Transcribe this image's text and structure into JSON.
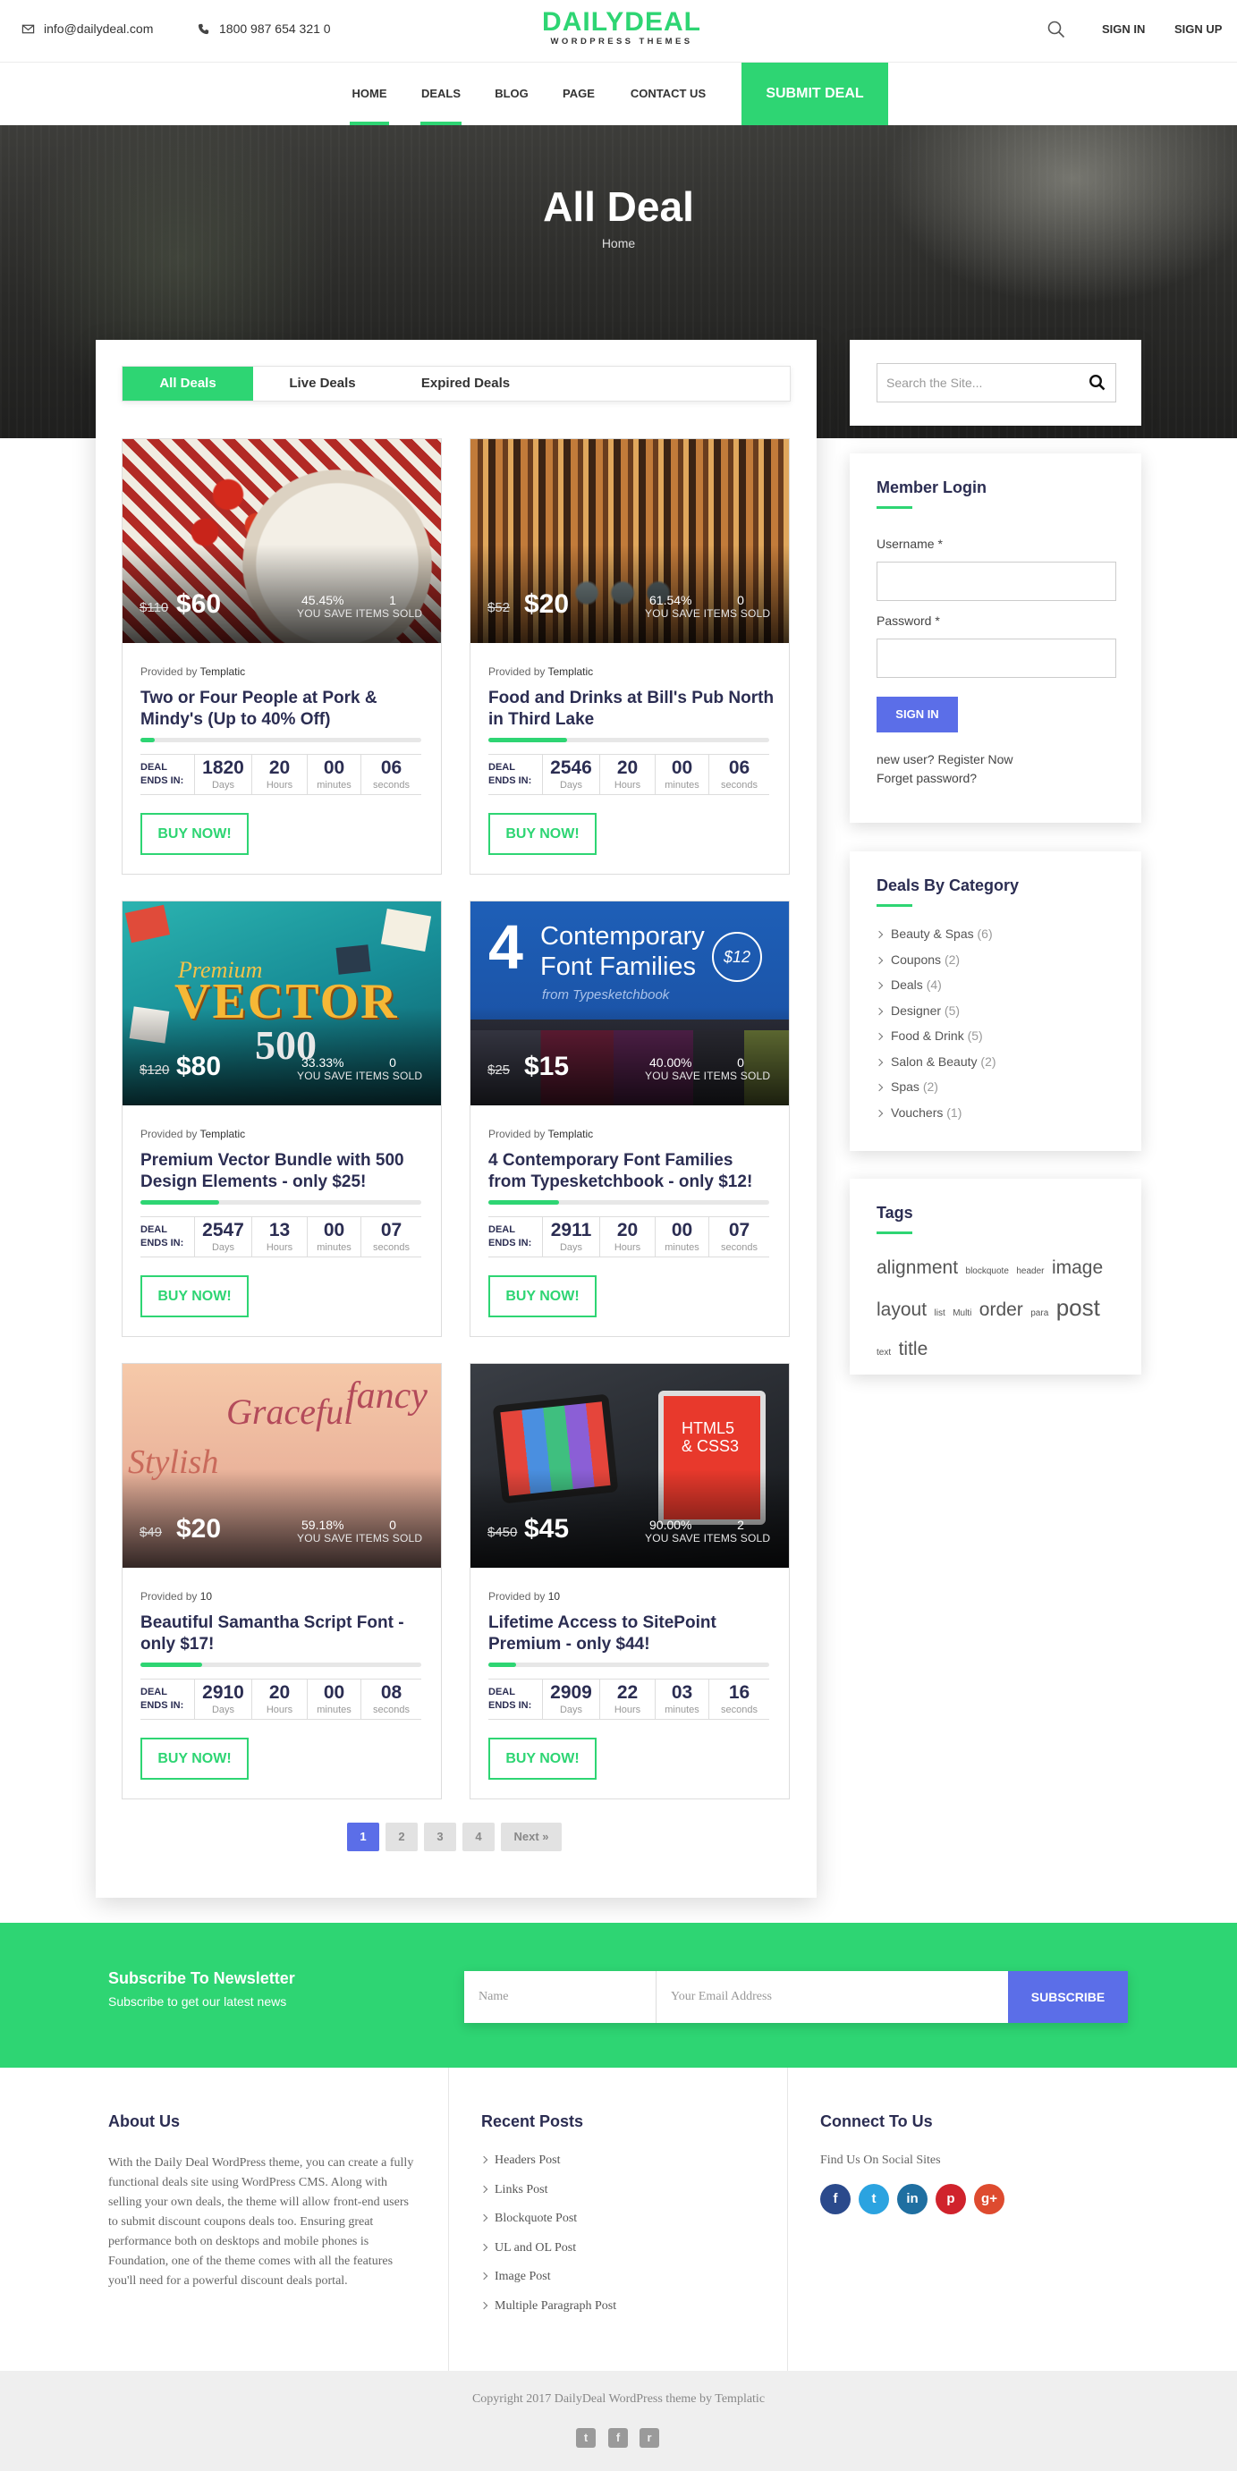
{
  "header": {
    "email": "info@dailydeal.com",
    "phone": "1800 987 654 321 0",
    "logo_main": "DAILYDEAL",
    "logo_sub": "WORDPRESS THEMES",
    "sign_in": "SIGN IN",
    "sign_up": "SIGN UP",
    "nav": [
      "HOME",
      "DEALS",
      "BLOG",
      "PAGE",
      "CONTACT US"
    ],
    "submit_deal": "SUBMIT DEAL"
  },
  "hero": {
    "title": "All Deal",
    "breadcrumb": "Home"
  },
  "tabs": [
    "All Deals",
    "Live Deals",
    "Expired Deals"
  ],
  "deal_labels": {
    "provided_by": "Provided by",
    "save_label": "YOU SAVE ITEMS SOLD",
    "deal_ends_line1": "DEAL",
    "deal_ends_line2": "ENDS IN:",
    "units": [
      "Days",
      "Hours",
      "minutes",
      "seconds"
    ],
    "buy_now": "BUY NOW!"
  },
  "deals": [
    {
      "old_price": "$110",
      "new_price": "$60",
      "percent": "45.45%",
      "sold": "1",
      "provider": "Templatic",
      "title": "Two or Four People at Pork & Mindy's (Up to 40% Off)",
      "progress": 0.05,
      "days": "1820",
      "hours": "20",
      "minutes": "00",
      "seconds": "06"
    },
    {
      "old_price": "$52",
      "new_price": "$20",
      "percent": "61.54%",
      "sold": "0",
      "provider": "Templatic",
      "title": "Food and Drinks at Bill's Pub North in Third Lake",
      "progress": 0.28,
      "days": "2546",
      "hours": "20",
      "minutes": "00",
      "seconds": "06"
    },
    {
      "old_price": "$120",
      "new_price": "$80",
      "percent": "33.33%",
      "sold": "0",
      "provider": "Templatic",
      "title": "Premium Vector Bundle with 500 Design Elements - only $25!",
      "progress": 0.28,
      "days": "2547",
      "hours": "13",
      "minutes": "00",
      "seconds": "07"
    },
    {
      "old_price": "$25",
      "new_price": "$15",
      "percent": "40.00%",
      "sold": "0",
      "provider": "Templatic",
      "title": "4 Contemporary Font Families from Typesketchbook - only $12!",
      "progress": 0.25,
      "days": "2911",
      "hours": "20",
      "minutes": "00",
      "seconds": "07"
    },
    {
      "old_price": "$49",
      "new_price": "$20",
      "percent": "59.18%",
      "sold": "0",
      "provider": "10",
      "title": "Beautiful Samantha Script Font - only $17!",
      "progress": 0.22,
      "days": "2910",
      "hours": "20",
      "minutes": "00",
      "seconds": "08"
    },
    {
      "old_price": "$450",
      "new_price": "$45",
      "percent": "90.00%",
      "sold": "2",
      "provider": "10",
      "title": "Lifetime Access to SitePoint Premium - only $44!",
      "progress": 0.1,
      "days": "2909",
      "hours": "22",
      "minutes": "03",
      "seconds": "16"
    }
  ],
  "thumb_text": {
    "font_families": "Contemporary\nFont Families",
    "font_number": "4",
    "font_sub": "from Typesketchbook",
    "font_badge": "$12",
    "vector_word": "VECTOR",
    "vector_premium": "Premium",
    "vector_500": "500",
    "graceful": "Graceful",
    "fancy": "fancy",
    "stylish": "Stylish",
    "html5": "HTML5\n& CSS3"
  },
  "pagination": [
    "1",
    "2",
    "3",
    "4",
    "Next »"
  ],
  "sidebar": {
    "search_placeholder": "Search the Site...",
    "login_title": "Member Login",
    "username_label": "Username *",
    "password_label": "Password *",
    "sign_in_button": "SIGN IN",
    "register_text": "new user? Register Now",
    "forget_text": "Forget password?",
    "categories_title": "Deals By Category",
    "categories": [
      {
        "name": "Beauty & Spas",
        "count": "(6)"
      },
      {
        "name": "Coupons",
        "count": "(2)"
      },
      {
        "name": "Deals",
        "count": "(4)"
      },
      {
        "name": "Designer",
        "count": "(5)"
      },
      {
        "name": "Food & Drink",
        "count": "(5)"
      },
      {
        "name": "Salon & Beauty",
        "count": "(2)"
      },
      {
        "name": "Spas",
        "count": "(2)"
      },
      {
        "name": "Vouchers",
        "count": "(1)"
      }
    ],
    "tags_title": "Tags",
    "tags": [
      "alignment",
      "blockquote",
      "header",
      "image",
      "layout",
      "list",
      "Multi",
      "order",
      "para",
      "post",
      "text",
      "title"
    ]
  },
  "newsletter": {
    "title": "Subscribe To Newsletter",
    "subtitle": "Subscribe to get our latest news",
    "name_placeholder": "Name",
    "email_placeholder": "Your Email Address",
    "button": "SUBSCRIBE"
  },
  "footer": {
    "about_title": "About Us",
    "about_text": "With the Daily Deal WordPress theme, you can create a fully functional deals site using WordPress CMS. Along with selling your own deals, the theme will allow front-end users to submit discount coupons deals too. Ensuring great performance both on desktops and mobile phones is Foundation, one of the theme comes with all the features you'll need for a powerful discount deals portal.",
    "recent_title": "Recent Posts",
    "recent_posts": [
      "Headers Post",
      "Links Post",
      "Blockquote Post",
      "UL and OL Post",
      "Image Post",
      "Multiple Paragraph Post"
    ],
    "connect_title": "Connect To Us",
    "connect_sub": "Find Us On Social Sites",
    "social": [
      "facebook-icon",
      "twitter-icon",
      "linkedin-icon",
      "pinterest-icon",
      "google-plus-icon"
    ],
    "copyright": "Copyright 2017 DailyDeal WordPress theme by Templatic"
  },
  "colors": {
    "brand_green": "#2ed573",
    "accent_blue": "#5b6ee8",
    "heading_navy": "#2b2d52"
  }
}
